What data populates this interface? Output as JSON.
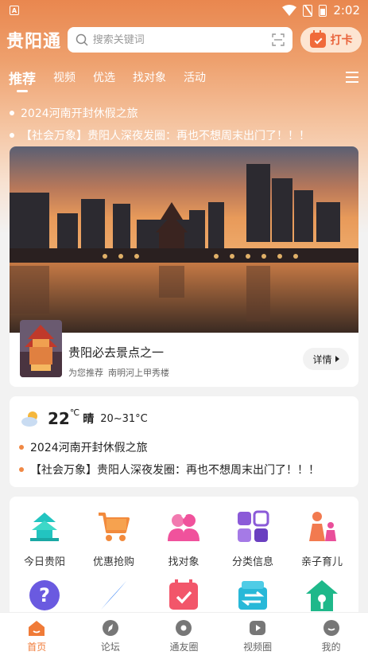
{
  "status": {
    "time": "2:02",
    "app_badge": "A"
  },
  "header": {
    "logo": "贵阳通",
    "search_placeholder": "搜索关键词",
    "checkin_label": "打卡"
  },
  "tabs": [
    {
      "label": "推荐",
      "active": true
    },
    {
      "label": "视频"
    },
    {
      "label": "优选"
    },
    {
      "label": "找对象"
    },
    {
      "label": "活动"
    }
  ],
  "headlines": [
    "2024河南开封休假之旅",
    "【社会万象】贵阳人深夜发圈：再也不想周末出门了！！！"
  ],
  "banner": {
    "title": "贵阳必去景点之一",
    "tag": "为您推荐",
    "location": "南明河上甲秀楼",
    "detail_label": "详情"
  },
  "weather": {
    "temp": "22",
    "unit": "℃",
    "condition": "晴",
    "range": "20~31°C",
    "news": [
      "2024河南开封休假之旅",
      "【社会万象】贵阳人深夜发圈：再也不想周末出门了！！！"
    ]
  },
  "grid": [
    {
      "label": "今日贵阳",
      "icon": "pavilion-icon",
      "color": "#22c4c0"
    },
    {
      "label": "优惠抢购",
      "icon": "cart-icon",
      "color": "#f28a3c"
    },
    {
      "label": "找对象",
      "icon": "couple-icon",
      "color": "#f0529c"
    },
    {
      "label": "分类信息",
      "icon": "category-icon",
      "color": "#8b5ad8"
    },
    {
      "label": "亲子育儿",
      "icon": "parent-child-icon",
      "color": "#f27a4f"
    },
    {
      "label": "",
      "icon": "question-icon",
      "color": "#6a5ae0"
    },
    {
      "label": "",
      "icon": "compass-icon",
      "color": "#2f7cf2"
    },
    {
      "label": "",
      "icon": "calendar-check-icon",
      "color": "#f2566a"
    },
    {
      "label": "",
      "icon": "exchange-icon",
      "color": "#28b8d8"
    },
    {
      "label": "",
      "icon": "house-key-icon",
      "color": "#1fb88a"
    }
  ],
  "bottom_nav": [
    {
      "label": "首页",
      "active": true
    },
    {
      "label": "论坛"
    },
    {
      "label": "通友圈"
    },
    {
      "label": "视频圈"
    },
    {
      "label": "我的"
    }
  ]
}
